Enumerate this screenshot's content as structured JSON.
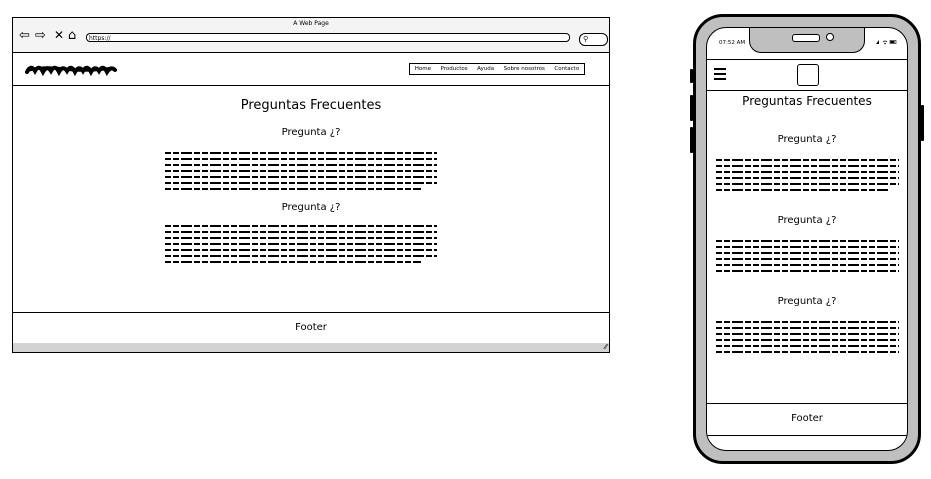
{
  "desktop": {
    "window_title": "A Web Page",
    "nav_icons": {
      "back": "back-arrow-icon",
      "forward": "forward-arrow-icon",
      "close": "close-icon",
      "home": "home-icon"
    },
    "url": "https://",
    "search_icon": "search-icon",
    "top_nav": [
      "Home",
      "Productos",
      "Ayuda",
      "Sobre nosotros",
      "Contacto"
    ],
    "page_title": "Preguntas Frecuentes",
    "questions": [
      {
        "heading": "Pregunta ¿?"
      },
      {
        "heading": "Pregunta ¿?"
      }
    ],
    "footer": "Footer"
  },
  "mobile": {
    "status_time": "07:52 AM",
    "status_icons": "signal-wifi-battery-icons",
    "page_title": "Preguntas Frecuentes",
    "questions": [
      {
        "heading": "Pregunta ¿?"
      },
      {
        "heading": "Pregunta ¿?"
      },
      {
        "heading": "Pregunta ¿?"
      }
    ],
    "footer": "Footer"
  }
}
